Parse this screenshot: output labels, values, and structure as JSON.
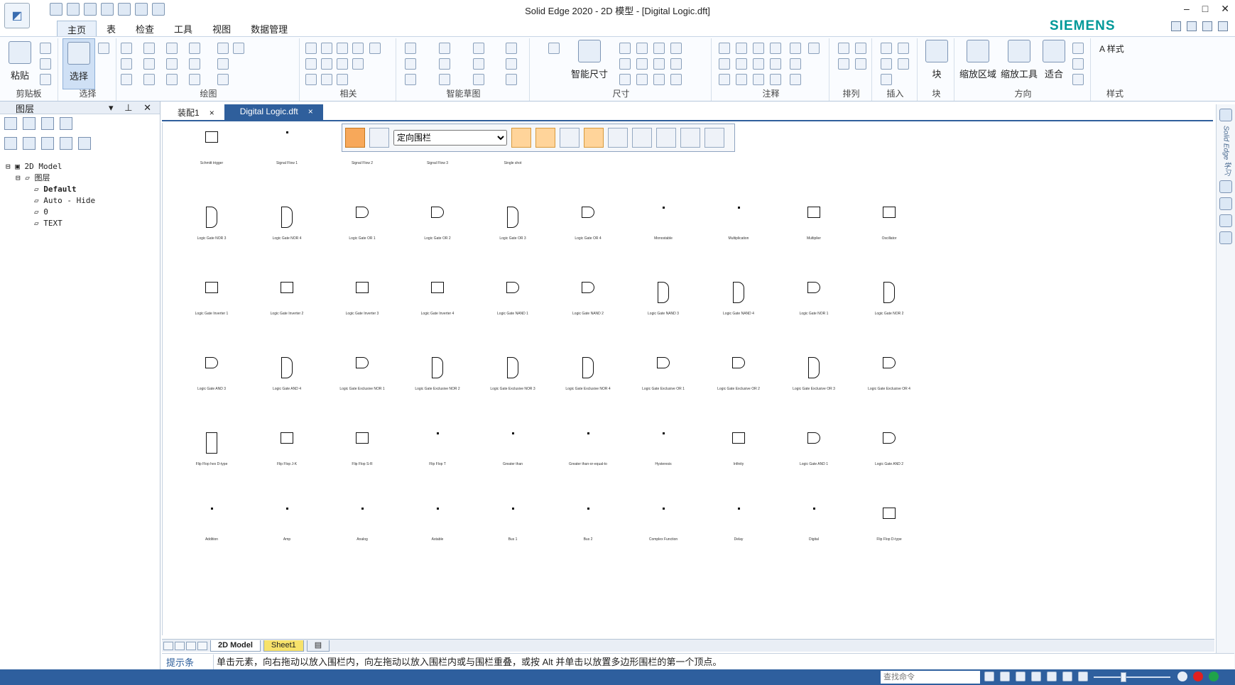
{
  "app": {
    "title": "Solid Edge 2020 - 2D 模型 - [Digital Logic.dft]",
    "brand": "SIEMENS",
    "window_controls": [
      "–",
      "□",
      "✕"
    ]
  },
  "ribbon_tabs": [
    {
      "label": "主页",
      "active": true
    },
    {
      "label": "表"
    },
    {
      "label": "检查"
    },
    {
      "label": "工具"
    },
    {
      "label": "视图"
    },
    {
      "label": "数据管理"
    }
  ],
  "ribbon": {
    "groups": [
      {
        "label": "剪贴板",
        "big": "粘贴"
      },
      {
        "label": "选择",
        "big": "选择"
      },
      {
        "label": "绘图"
      },
      {
        "label": "相关"
      },
      {
        "label": "智能草图"
      },
      {
        "label": "尺寸",
        "big": "智能尺寸"
      },
      {
        "label": "注释"
      },
      {
        "label": "排列"
      },
      {
        "label": "插入"
      },
      {
        "label": "块",
        "big": "块"
      },
      {
        "label": "方向",
        "big1": "缩放区域",
        "big2": "缩放工具",
        "big3": "适合"
      },
      {
        "label": "样式",
        "small": "样式"
      }
    ]
  },
  "layers_pane": {
    "title": "图层",
    "tree": [
      "2D Model",
      "图层",
      "Default",
      "Auto - Hide",
      "0",
      "TEXT"
    ]
  },
  "doc_tabs": [
    {
      "label": "装配1",
      "close": "×"
    },
    {
      "label": "Digital Logic.dft",
      "close": "×",
      "active": true
    }
  ],
  "fence_toolbar": {
    "selected_option": "定向围栏"
  },
  "symbols": [
    "Schmitt trigger",
    "Signal Flow 1",
    "Signal Flow 2",
    "Signal Flow 3",
    "Single shot",
    "Logic Gate NOR 3",
    "Logic Gate NOR 4",
    "Logic Gate OR 1",
    "Logic Gate OR 2",
    "Logic Gate OR 3",
    "Logic Gate OR 4",
    "Monostable",
    "Multiplication",
    "Multiplier",
    "Oscillator",
    "Logic Gate Inverter 1",
    "Logic Gate Inverter 2",
    "Logic Gate Inverter 3",
    "Logic Gate Inverter 4",
    "Logic Gate NAND 1",
    "Logic Gate NAND 2",
    "Logic Gate NAND 3",
    "Logic Gate NAND 4",
    "Logic Gate NOR 1",
    "Logic Gate NOR 2",
    "Logic Gate AND 3",
    "Logic Gate AND 4",
    "Logic Gate Exclusive NOR 1",
    "Logic Gate Exclusive NOR 2",
    "Logic Gate Exclusive NOR 3",
    "Logic Gate Exclusive NOR 4",
    "Logic Gate Exclusive OR 1",
    "Logic Gate Exclusive OR 2",
    "Logic Gate Exclusive OR 3",
    "Logic Gate Exclusive OR 4",
    "Flip Flop hex D-type",
    "Flip Flop J-K",
    "Flip Flop S-R",
    "Flip Flop T",
    "Greater than",
    "Greater than-or-equal-to",
    "Hysteresis",
    "Infinity",
    "Logic Gate AND 1",
    "Logic Gate AND 2",
    "Addition",
    "Amp",
    "Analog",
    "Astable",
    "Bus 1",
    "Bus 2",
    "Complex Function",
    "Delay",
    "Digital",
    "Flip Flop D-type"
  ],
  "sheet_tabs": [
    {
      "label": "2D Model",
      "active": true
    },
    {
      "label": "Sheet1"
    }
  ],
  "prompt": {
    "title": "提示条",
    "text": "单击元素，向右拖动以放入围栏内，向左拖动以放入围栏内或与围栏重叠，或按 Alt 并单击以放置多边形围栏的第一个顶点。"
  },
  "status": {
    "search_placeholder": "查找命令"
  },
  "right_rail": {
    "vertical_text": "Solid Edge 学习"
  }
}
